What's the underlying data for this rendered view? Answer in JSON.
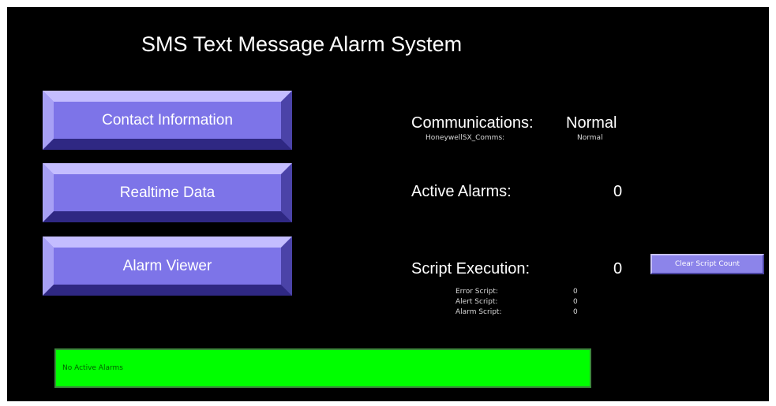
{
  "title": "SMS Text Message Alarm System",
  "nav": {
    "contact": "Contact Information",
    "realtime": "Realtime Data",
    "alarm_viewer": "Alarm Viewer"
  },
  "communications": {
    "label": "Communications:",
    "value": "Normal",
    "sub_label": "HoneywellSX_Comms:",
    "sub_value": "Normal"
  },
  "active_alarms": {
    "label": "Active Alarms:",
    "value": "0"
  },
  "script_execution": {
    "label": "Script Execution:",
    "value": "0",
    "clear_button": "Clear Script Count",
    "scripts": [
      {
        "label": "Error Script:",
        "value": "0"
      },
      {
        "label": "Alert Script:",
        "value": "0"
      },
      {
        "label": "Alarm Script:",
        "value": "0"
      }
    ]
  },
  "alarm_banner": {
    "text": "No Active Alarms",
    "color": "#00ff00"
  },
  "colors": {
    "background": "#000000",
    "button": "#7d74e8",
    "text": "#ffffff"
  }
}
